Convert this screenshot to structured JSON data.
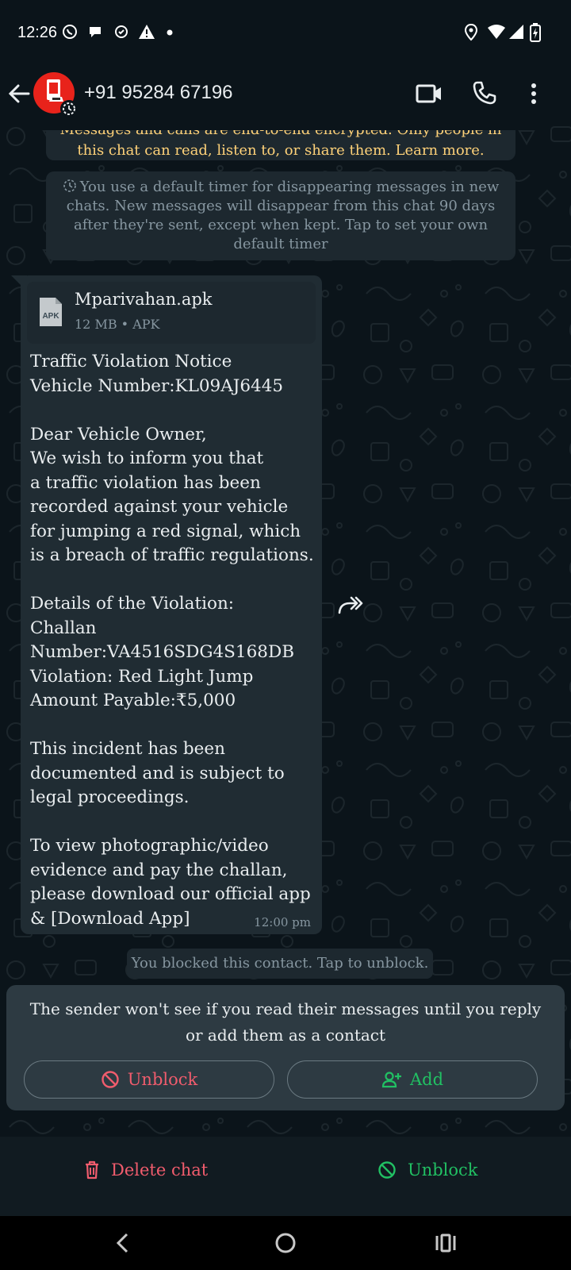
{
  "status_bar": {
    "time": "12:26"
  },
  "header": {
    "contact": "+91 95284 67196",
    "icons": [
      "back-arrow-icon",
      "video-call-icon",
      "voice-call-icon",
      "more-options-icon"
    ]
  },
  "notices": {
    "e2e_line1": "Messages and calls are end-to-end encrypted. Only people in",
    "e2e_line2": "this chat can read, listen to, or share them. Learn more.",
    "timer_text": "You use a default timer for disappearing messages in new chats. New messages will disappear from this chat 90 days after they're sent, except when kept. Tap to set your own default timer"
  },
  "message": {
    "file_name": "Mparivahan.apk",
    "file_meta": "12 MB • APK",
    "file_type_label": "APK",
    "lines": [
      "Traffic Violation Notice",
      "Vehicle Number:KL09AJ6445",
      "",
      "Dear Vehicle Owner,",
      "We wish to inform you that",
      "a traffic violation has been",
      "recorded against your vehicle",
      "for jumping a red signal, which",
      "is a breach of traffic regulations.",
      "",
      "Details of the Violation:",
      "Challan",
      "Number:VA4516SDG4S168DB",
      "Violation: Red Light Jump",
      "Amount Payable:₹5,000",
      "",
      "This incident has been",
      "documented and is subject to",
      "legal proceedings.",
      "",
      "To view photographic/video",
      "evidence and pay the challan,",
      "please download our official app",
      "& [Download App]"
    ],
    "time": "12:00 pm"
  },
  "blocked_notice": "You blocked this contact. Tap to unblock.",
  "sender_card": {
    "text": "The sender won't see if you read their messages until you reply or add them as a contact",
    "unblock_label": "Unblock",
    "add_label": "Add"
  },
  "bottom_actions": {
    "delete_label": "Delete chat",
    "unblock_label": "Unblock"
  },
  "colors": {
    "background": "#0b141a",
    "bubble": "#202c33",
    "danger": "#f15c6d",
    "accent_green": "#21c063",
    "notice_yellow": "#ffd279"
  }
}
